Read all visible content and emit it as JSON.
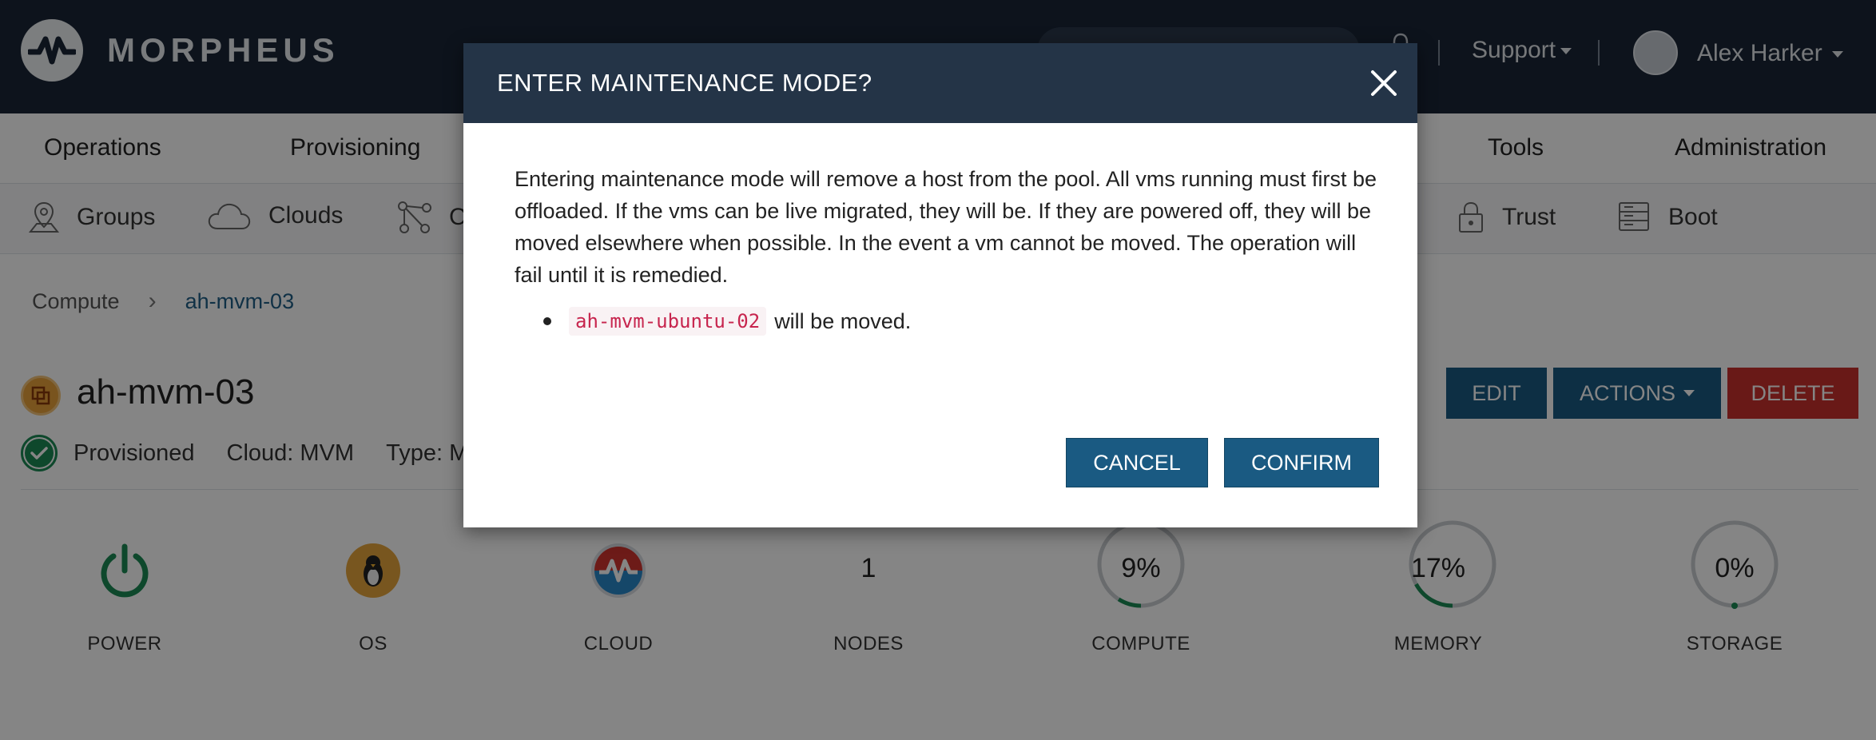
{
  "header": {
    "brand": "MORPHEUS",
    "support_label": "Support",
    "user_name": "Alex Harker"
  },
  "main_nav": {
    "items": [
      {
        "label": "Operations"
      },
      {
        "label": "Provisioning"
      },
      {
        "label": "Tools"
      },
      {
        "label": "Administration"
      }
    ]
  },
  "sub_nav": {
    "items": [
      {
        "label": "Groups",
        "icon": "map-pin-icon"
      },
      {
        "label": "Clouds",
        "icon": "cloud-icon"
      },
      {
        "label": "C",
        "icon": "network-icon"
      },
      {
        "label": "Trust",
        "icon": "lock-icon"
      },
      {
        "label": "Boot",
        "icon": "server-icon"
      }
    ]
  },
  "breadcrumb": {
    "root": "Compute",
    "current": "ah-mvm-03"
  },
  "host": {
    "name": "ah-mvm-03",
    "status": "Provisioned",
    "cloud": "Cloud: MVM",
    "type": "Type: MV"
  },
  "host_actions": {
    "edit_label": "EDIT",
    "actions_label": "ACTIONS",
    "delete_label": "DELETE"
  },
  "stats": [
    {
      "label": "POWER",
      "icon": "power-icon",
      "value": ""
    },
    {
      "label": "OS",
      "icon": "linux-penguin-icon",
      "value": ""
    },
    {
      "label": "CLOUD",
      "icon": "morpheus-cloud-icon",
      "value": ""
    },
    {
      "label": "NODES",
      "icon": "",
      "value": "1"
    },
    {
      "label": "COMPUTE",
      "icon": "",
      "value": "9%",
      "percent": 9
    },
    {
      "label": "MEMORY",
      "icon": "",
      "value": "17%",
      "percent": 17
    },
    {
      "label": "STORAGE",
      "icon": "",
      "value": "0%",
      "percent": 0
    }
  ],
  "colors": {
    "header_bg": "#1a2636",
    "primary_button": "#1a5a82",
    "danger_button": "#c9302c",
    "success": "#1b8a55",
    "code_text": "#c7254e"
  },
  "modal": {
    "title": "ENTER MAINTENANCE MODE?",
    "body": "Entering maintenance mode will remove a host from the pool. All vms running must first be offloaded. If the vms can be live migrated, they will be. If they are powered off, they will be moved elsewhere when possible. In the event a vm cannot be moved. The operation will fail until it is remedied.",
    "vm_name": "ah-mvm-ubuntu-02",
    "vm_suffix": "will be moved.",
    "cancel_label": "CANCEL",
    "confirm_label": "CONFIRM"
  }
}
